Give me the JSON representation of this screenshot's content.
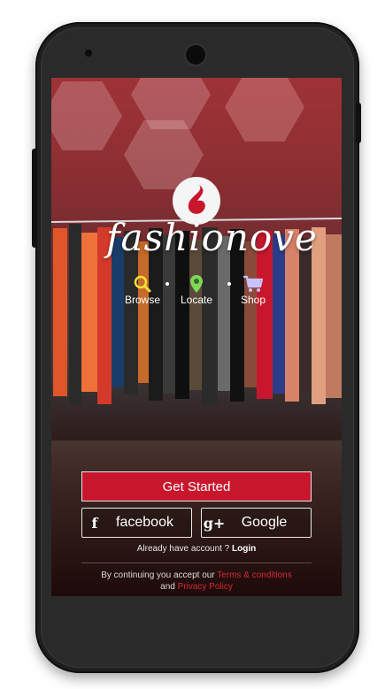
{
  "brand": {
    "name": "fashionove"
  },
  "features": [
    {
      "label": "Browse",
      "icon": "search-icon"
    },
    {
      "label": "Locate",
      "icon": "location-pin-icon"
    },
    {
      "label": "Shop",
      "icon": "cart-icon"
    }
  ],
  "actions": {
    "get_started": "Get Started",
    "facebook": "facebook",
    "facebook_icon": "f",
    "google": "Google",
    "google_icon": "g+"
  },
  "account": {
    "prompt": "Already have account ?",
    "login": "Login"
  },
  "legal": {
    "prefix": "By continuing you accept our",
    "terms": "Terms & conditions",
    "and": "and",
    "privacy": "Privacy Policy"
  },
  "colors": {
    "accent": "#c8172d",
    "link": "#d8282f"
  }
}
